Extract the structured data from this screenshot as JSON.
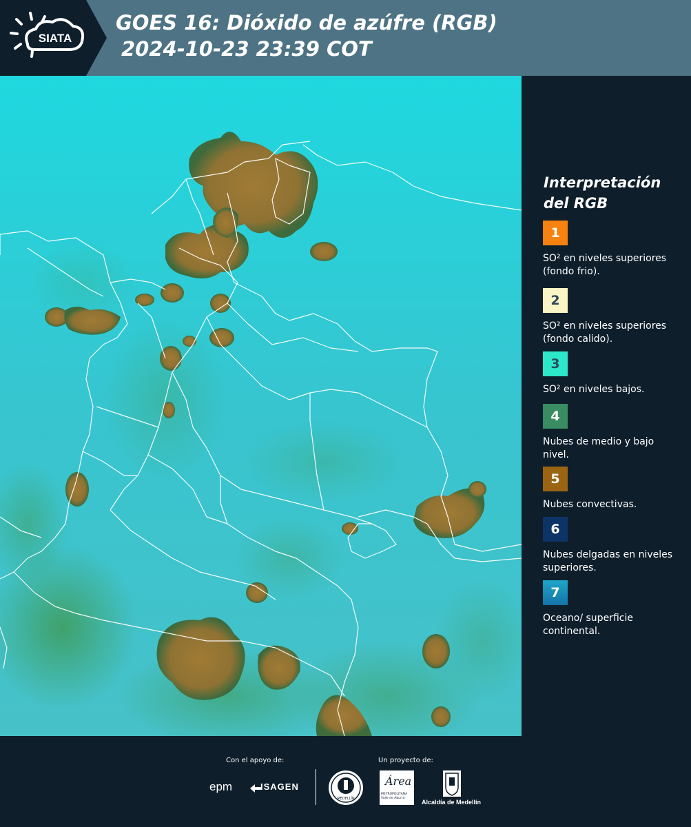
{
  "header": {
    "logo_text": "SIATA",
    "title_line1": "GOES 16: Dióxido de azúfre (RGB)",
    "title_line2": "2024-10-23 23:39 COT",
    "background_color": "#4d7384"
  },
  "map": {
    "ocean_color": "#2fc7d3",
    "cloud_color": "#9a7a36",
    "border_color": "#ffffff"
  },
  "legend": {
    "title": "Interpretación del RGB",
    "items": [
      {
        "number": "1",
        "color": "#f7820f",
        "text": "SO² en niveles superiores (fondo frio)."
      },
      {
        "number": "2",
        "color": "#fbf4c4",
        "text": "SO² en niveles superiores (fondo calido)."
      },
      {
        "number": "3",
        "color": "#2ce8c9",
        "text": "SO² en niveles bajos."
      },
      {
        "number": "4",
        "color": "#3a8c63",
        "text": "Nubes de medio y bajo nivel."
      },
      {
        "number": "5",
        "color": "#9b6413",
        "text": "Nubes convectivas."
      },
      {
        "number": "6",
        "color": "#0d3466",
        "text": "Nubes delgadas en niveles superiores."
      },
      {
        "number": "7",
        "color": "#1d8cc0",
        "text": "Oceano/ superficie continental."
      }
    ]
  },
  "footer": {
    "support_label": "Con el apoyo de:",
    "project_label": "Un proyecto de:",
    "sponsor_epm": "epm",
    "sponsor_isagen": "ISAGEN",
    "medellin_seal_text": "MEDELLÍN",
    "area_text": "Área",
    "area_subtext": "METROPOLITANA Valle de Aburrá",
    "alcaldia_text": "Alcaldía de Medellín"
  }
}
